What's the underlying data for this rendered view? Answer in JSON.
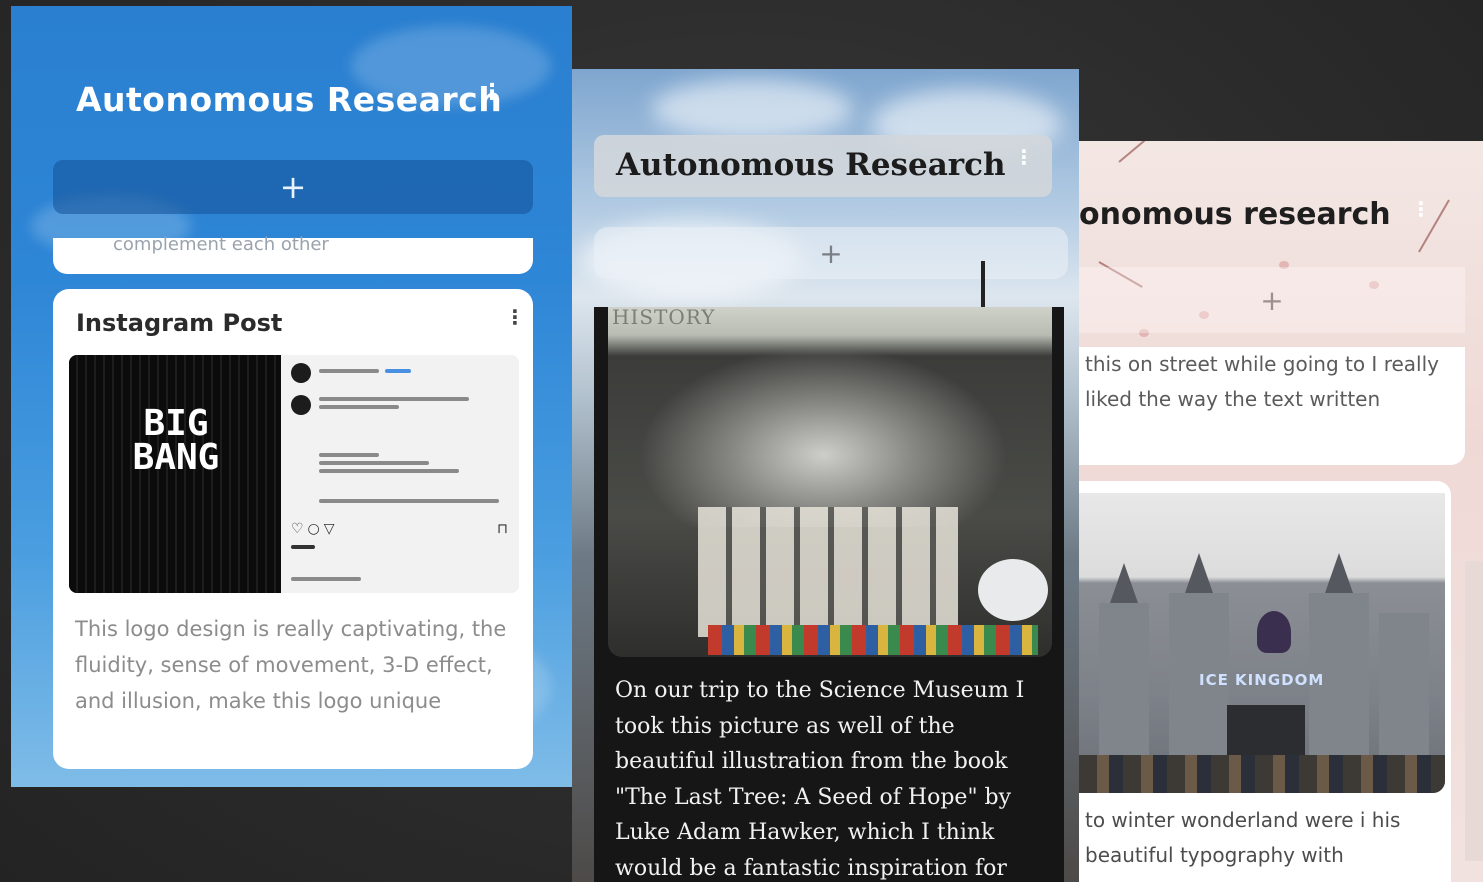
{
  "panel_blue": {
    "app_title": "Autonomous Research",
    "menu_icon": "⋮",
    "add_icon": "+",
    "prev_card_cut_text": "complement each other",
    "card": {
      "title": "Instagram Post",
      "menu_icon": "⋮",
      "logo_text": "BIG BANG",
      "description": "This logo design is really captivating, the fluidity, sense of movement, 3-D effect, and illusion, make this logo unique"
    }
  },
  "panel_sky": {
    "app_title": "Autonomous Research",
    "menu_icon": "⋮",
    "add_icon": "+",
    "photo_sign": "HISTORY",
    "description": "On our trip to the Science Museum I took this picture as well of the beautiful illustration from the book \"The Last Tree: A Seed of Hope\" by Luke Adam Hawker, which I think would be a fantastic inspiration for"
  },
  "panel_blossom": {
    "app_title": "onomous research",
    "menu_icon": "⋮",
    "add_icon": "+",
    "prev_card_text": "this on street while going to I really liked the way the text written",
    "card": {
      "menu_icon": "⋮",
      "photo_sign": "ICE KINGDOM",
      "description": "to winter wonderland were i his beautiful typography with"
    }
  },
  "colors": {
    "blue_theme": "#2e86d6",
    "dark_card": "#161616",
    "blossom_bg": "#f3e7e4"
  }
}
